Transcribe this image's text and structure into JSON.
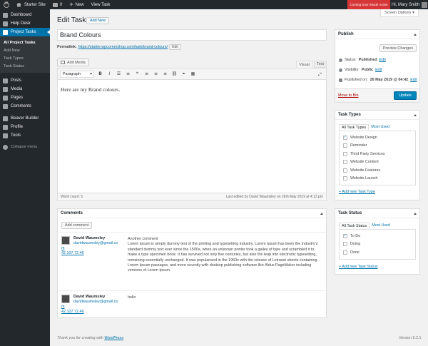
{
  "admin_bar": {
    "site_name": "Starter Site",
    "comments_count": "0",
    "new_label": "New",
    "view_label": "View Task",
    "coming_soon": "Coming Soon Mode Active",
    "howdy": "Hi, Mary Smith"
  },
  "sidebar": {
    "items": [
      {
        "label": "Dashboard"
      },
      {
        "label": "Help Desk"
      },
      {
        "label": "Project Tasks"
      },
      {
        "label": "Posts"
      },
      {
        "label": "Media"
      },
      {
        "label": "Pages"
      },
      {
        "label": "Comments"
      },
      {
        "label": "Beaver Builder"
      },
      {
        "label": "Profile"
      },
      {
        "label": "Tools"
      }
    ],
    "submenu": [
      "All Project Tasks",
      "Add New",
      "Task Types",
      "Task Status"
    ],
    "collapse": "Collapse menu"
  },
  "screen_options": "Screen Options",
  "page_title": "Edit Task",
  "add_new": "Add New",
  "title_value": "Brand Colours",
  "permalink": {
    "label": "Permalink:",
    "url": "https://starter.wpcornershop.com/task/brand-colours/",
    "edit": "Edit"
  },
  "editor": {
    "add_media": "Add Media",
    "tab_visual": "Visual",
    "tab_text": "Text",
    "format": "Paragraph",
    "content": "Here are my Brand colours.",
    "word_count": "Word count: 5",
    "last_edited": "Last edited by David Waumsley on 26th May 2019 at 4:13 pm"
  },
  "comments": {
    "title": "Comments",
    "add_comment": "Add comment",
    "list": [
      {
        "author": "David Waumsley",
        "email": "davidwaumsley@gmail.co",
        "email_tail": "m",
        "ip": "42.107.72.46",
        "heading": "Another comment",
        "text": "Lorem Ipsum is simply dummy text of the printing and typesetting industry. Lorem Ipsum has been the industry's standard dummy text ever since the 1500s, when an unknown printer took a galley of type and scrambled it to make a type specimen book. It has survived not only five centuries, but also the leap into electronic typesetting, remaining essentially unchanged. It was popularised in the 1960s with the release of Letraset sheets containing Lorem Ipsum passages, and more recently with desktop publishing software like Aldus PageMaker including versions of Lorem Ipsum."
      },
      {
        "author": "David Waumsley",
        "email": "davidwaumsley@gmail.co",
        "email_tail": "m",
        "ip": "42.107.72.46",
        "heading": "",
        "text": "hello"
      }
    ]
  },
  "publish": {
    "title": "Publish",
    "preview": "Preview Changes",
    "status_label": "Status:",
    "status_value": "Published",
    "visibility_label": "Visibility:",
    "visibility_value": "Public",
    "published_label": "Published on:",
    "published_value": "26 May 2019 @ 04:42",
    "edit": "Edit",
    "trash": "Move to Bin",
    "update": "Update"
  },
  "task_types": {
    "title": "Task Types",
    "tab_all": "All Task Types",
    "tab_most": "Most Used",
    "items": [
      {
        "label": "Website Design",
        "checked": true
      },
      {
        "label": "Reminder",
        "checked": false
      },
      {
        "label": "Third Party Services",
        "checked": false
      },
      {
        "label": "Website Content",
        "checked": false
      },
      {
        "label": "Website Features",
        "checked": false
      },
      {
        "label": "Website Launch",
        "checked": false
      }
    ],
    "add_new": "+ Add new Task Type"
  },
  "task_status": {
    "title": "Task Status",
    "tab_all": "All Task Status",
    "tab_most": "Most Used",
    "items": [
      {
        "label": "To Do",
        "checked": true
      },
      {
        "label": "Doing",
        "checked": false
      },
      {
        "label": "Done",
        "checked": false
      }
    ],
    "add_new": "+ Add new Task Status"
  },
  "footer": {
    "thanks_prefix": "Thank you for creating with",
    "wordpress": "WordPress",
    "thanks_suffix": ".",
    "version": "Version 5.2.1"
  }
}
